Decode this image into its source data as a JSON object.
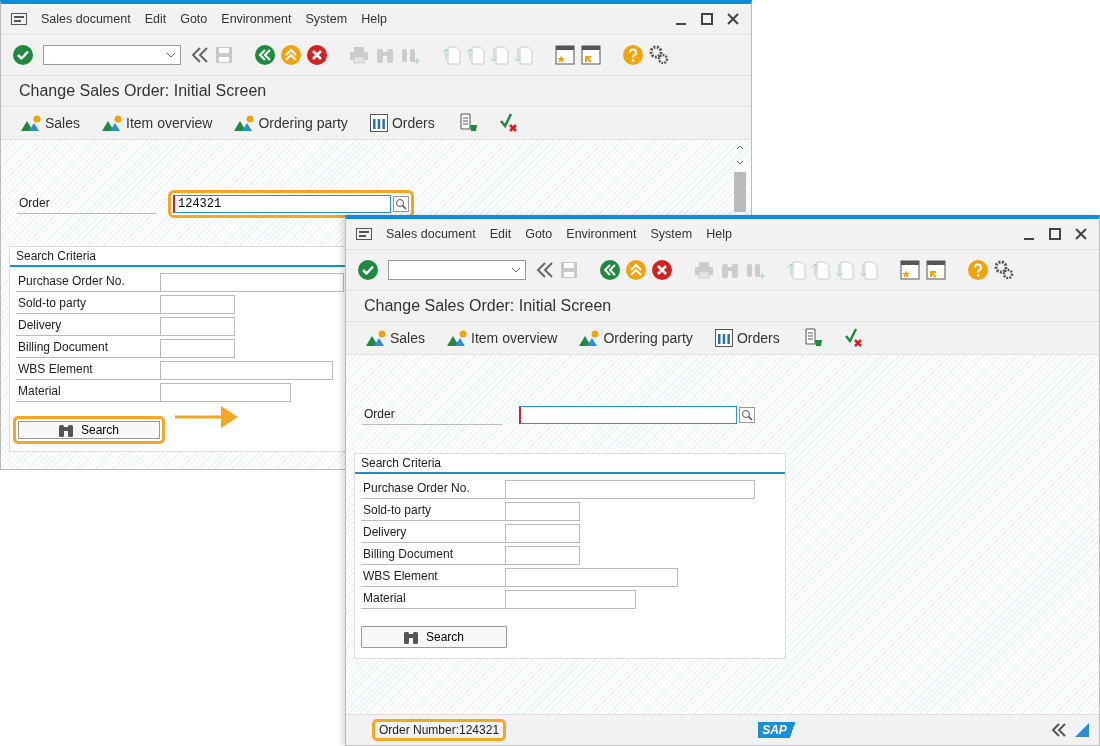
{
  "windows": [
    {
      "menu": [
        "Sales document",
        "Edit",
        "Goto",
        "Environment",
        "System",
        "Help"
      ],
      "title": "Change Sales Order: Initial Screen",
      "app_toolbar": [
        {
          "kind": "chart",
          "label": "Sales"
        },
        {
          "kind": "chart",
          "label": "Item overview"
        },
        {
          "kind": "chart",
          "label": "Ordering party"
        },
        {
          "kind": "table",
          "label": "Orders"
        },
        {
          "kind": "doc"
        },
        {
          "kind": "check"
        }
      ],
      "order": {
        "label": "Order",
        "value": "124321",
        "highlighted": true
      },
      "criteria": {
        "title": "Search Criteria",
        "fields": [
          {
            "label": "Purchase Order No.",
            "kind": "wide"
          },
          {
            "label": "Sold-to party",
            "kind": "short"
          },
          {
            "label": "Delivery",
            "kind": "short"
          },
          {
            "label": "Billing Document",
            "kind": "short"
          },
          {
            "label": "WBS Element",
            "kind": "long"
          },
          {
            "label": "Material",
            "kind": "medium"
          }
        ]
      },
      "search_button": {
        "label": "Search",
        "highlighted": true
      },
      "scrollbar": true
    },
    {
      "menu": [
        "Sales document",
        "Edit",
        "Goto",
        "Environment",
        "System",
        "Help"
      ],
      "title": "Change Sales Order: Initial Screen",
      "app_toolbar": [
        {
          "kind": "chart",
          "label": "Sales"
        },
        {
          "kind": "chart",
          "label": "Item overview"
        },
        {
          "kind": "chart",
          "label": "Ordering party"
        },
        {
          "kind": "table",
          "label": "Orders"
        },
        {
          "kind": "doc"
        },
        {
          "kind": "check"
        }
      ],
      "order": {
        "label": "Order",
        "highlighted": false
      },
      "criteria": {
        "title": "Search Criteria",
        "fields": [
          {
            "label": "Purchase Order No.",
            "kind": "wide"
          },
          {
            "label": "Sold-to party",
            "kind": "short"
          },
          {
            "label": "Delivery",
            "kind": "short"
          },
          {
            "label": "Billing Document",
            "kind": "short"
          },
          {
            "label": "WBS Element",
            "kind": "long"
          },
          {
            "label": "Material",
            "kind": "medium"
          }
        ]
      },
      "search_button": {
        "label": "Search",
        "highlighted": false
      },
      "scrollbar": false,
      "status": {
        "message": "Order Number:124321",
        "highlighted": true,
        "logo": "SAP"
      }
    }
  ]
}
